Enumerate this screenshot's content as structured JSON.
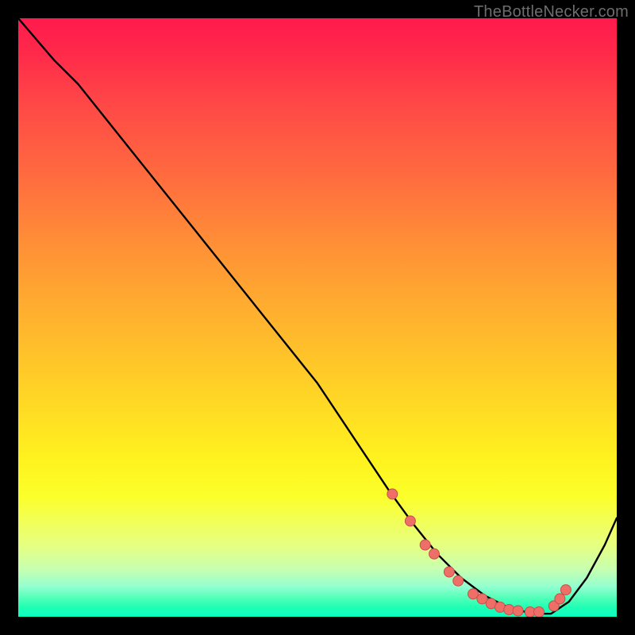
{
  "watermark": "TheBottleNecker.com",
  "colors": {
    "frame": "#000000",
    "curve": "#000000",
    "dot_fill": "#ee6f67",
    "dot_stroke": "#c94f48"
  },
  "chart_data": {
    "type": "line",
    "title": "",
    "xlabel": "",
    "ylabel": "",
    "xlim": [
      0,
      100
    ],
    "ylim": [
      0,
      100
    ],
    "series": [
      {
        "name": "bottleneck-curve",
        "x": [
          0,
          6,
          10,
          20,
          30,
          40,
          50,
          58,
          62,
          66,
          70,
          74,
          78,
          82,
          86,
          89,
          92,
          95,
          98,
          100
        ],
        "y": [
          100,
          93,
          89,
          76.5,
          64,
          51.5,
          39,
          27,
          21,
          15.5,
          10.5,
          6.5,
          3.5,
          1.5,
          0.5,
          0.5,
          2.5,
          6.5,
          12,
          16.5
        ]
      }
    ],
    "markers": {
      "name": "highlight-dots",
      "x": [
        62.5,
        65.5,
        68,
        69.5,
        72,
        73.5,
        76,
        77.5,
        79,
        80.5,
        82,
        83.5,
        85.5,
        87,
        89.5,
        90.5,
        91.5
      ],
      "y": [
        20.5,
        16,
        12,
        10.5,
        7.5,
        6,
        3.8,
        3,
        2.2,
        1.6,
        1.2,
        1,
        0.8,
        0.8,
        1.8,
        3,
        4.5
      ]
    }
  }
}
